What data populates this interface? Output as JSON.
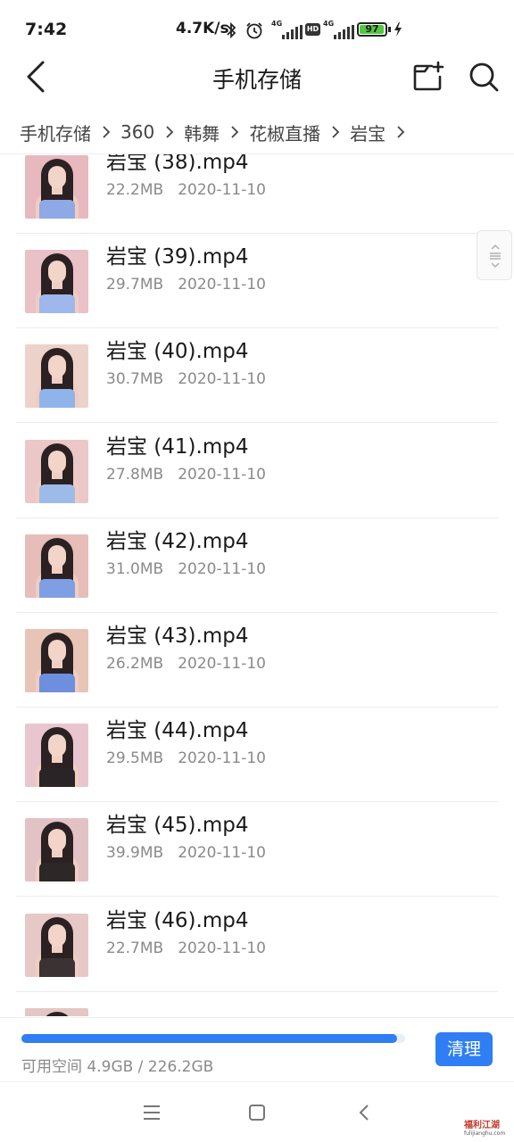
{
  "status_bar": {
    "time": "7:42",
    "network_speed": "4.7K/s",
    "battery_level": "97",
    "battery_fraction": 0.97,
    "icons": [
      "bluetooth-icon",
      "alarm-icon",
      "signal-4g-icon",
      "hd-icon",
      "signal-4g-icon",
      "battery-icon",
      "charging-icon"
    ]
  },
  "header": {
    "title": "手机存储",
    "back_icon": "chevron-left-icon",
    "new_folder_icon": "new-folder-icon",
    "search_icon": "search-icon"
  },
  "breadcrumb": [
    "手机存储",
    "360",
    "韩舞",
    "花椒直播",
    "岩宝"
  ],
  "files": [
    {
      "name": "岩宝 (38).mp4",
      "size": "22.2MB",
      "date": "2020-11-10",
      "thumb_bg": "#e7b9bf",
      "thumb_top": "#8fa8e6"
    },
    {
      "name": "岩宝 (39).mp4",
      "size": "29.7MB",
      "date": "2020-11-10",
      "thumb_bg": "#e9c1c6",
      "thumb_top": "#9eb7ec"
    },
    {
      "name": "岩宝 (40).mp4",
      "size": "30.7MB",
      "date": "2020-11-10",
      "thumb_bg": "#edd2c9",
      "thumb_top": "#8fb4e9"
    },
    {
      "name": "岩宝 (41).mp4",
      "size": "27.8MB",
      "date": "2020-11-10",
      "thumb_bg": "#ecc7c7",
      "thumb_top": "#9cbbe9"
    },
    {
      "name": "岩宝 (42).mp4",
      "size": "31.0MB",
      "date": "2020-11-10",
      "thumb_bg": "#e6bdb8",
      "thumb_top": "#7f9fe4"
    },
    {
      "name": "岩宝 (43).mp4",
      "size": "26.2MB",
      "date": "2020-11-10",
      "thumb_bg": "#e8c4b6",
      "thumb_top": "#6e8fdd"
    },
    {
      "name": "岩宝 (44).mp4",
      "size": "29.5MB",
      "date": "2020-11-10",
      "thumb_bg": "#e9c5cf",
      "thumb_top": "#2a2426"
    },
    {
      "name": "岩宝 (45).mp4",
      "size": "39.9MB",
      "date": "2020-11-10",
      "thumb_bg": "#e3c2c6",
      "thumb_top": "#2d2728"
    },
    {
      "name": "岩宝 (46).mp4",
      "size": "22.7MB",
      "date": "2020-11-10",
      "thumb_bg": "#e6c9c6",
      "thumb_top": "#3a3233"
    }
  ],
  "storage": {
    "label": "可用空间 4.9GB / 226.2GB",
    "used_fraction": 0.978,
    "button_label": "清理"
  },
  "nav_bar": {
    "menu_icon": "menu-icon",
    "home_icon": "home-square-icon",
    "back_icon": "back-triangle-icon"
  },
  "watermark": {
    "text": "福利江湖",
    "url": "fulijianghu.com"
  },
  "colors": {
    "accent": "#2f7ef3",
    "muted_text": "#8a8a8a",
    "battery": "#55c63f"
  }
}
